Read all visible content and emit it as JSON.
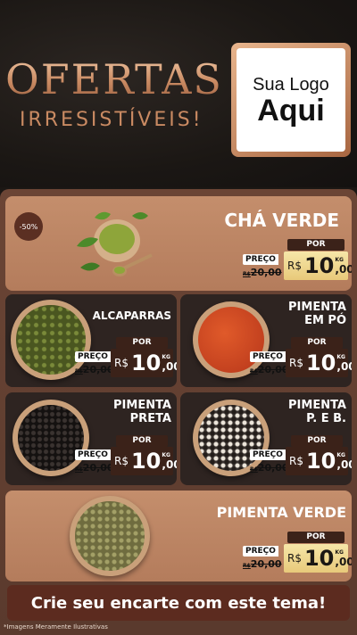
{
  "header": {
    "title": "OFERTAS",
    "subtitle": "IRRESISTÍVEIS!",
    "logo_line1": "Sua Logo",
    "logo_line2": "Aqui"
  },
  "featured": {
    "badge": "-50%",
    "name": "CHÁ VERDE",
    "price_label": "PREÇO",
    "old_price": "20,00",
    "old_currency": "R$",
    "por_label": "POR",
    "currency": "R$",
    "price_int": "10",
    "price_dec": ",00",
    "unit": "KG"
  },
  "products": [
    {
      "name_line1": "ALCAPARRAS",
      "name_line2": "",
      "price_label": "PREÇO",
      "old_currency": "R$",
      "old_price": "20,00",
      "por_label": "POR",
      "currency": "R$",
      "price_int": "10",
      "price_dec": ",00",
      "unit": "KG"
    },
    {
      "name_line1": "PIMENTA",
      "name_line2": "EM PÓ",
      "price_label": "PREÇO",
      "old_currency": "R$",
      "old_price": "20,00",
      "por_label": "POR",
      "currency": "R$",
      "price_int": "10",
      "price_dec": ",00",
      "unit": "KG"
    },
    {
      "name_line1": "PIMENTA",
      "name_line2": "PRETA",
      "price_label": "PREÇO",
      "old_currency": "R$",
      "old_price": "20,00",
      "por_label": "POR",
      "currency": "R$",
      "price_int": "10",
      "price_dec": ",00",
      "unit": "KG"
    },
    {
      "name_line1": "PIMENTA",
      "name_line2": "P. E B.",
      "price_label": "PREÇO",
      "old_currency": "R$",
      "old_price": "20,00",
      "por_label": "POR",
      "currency": "R$",
      "price_int": "10",
      "price_dec": ",00",
      "unit": "KG"
    }
  ],
  "bottom": {
    "name": "PIMENTA VERDE",
    "price_label": "PREÇO",
    "old_currency": "R$",
    "old_price": "20,00",
    "por_label": "POR",
    "currency": "R$",
    "price_int": "10",
    "price_dec": ",00",
    "unit": "KG"
  },
  "footer": {
    "cta": "Crie seu encarte com este tema!",
    "disclaimer": "*Imagens Meramente Ilustrativas"
  },
  "colors": {
    "accent_copper": "#c98a62",
    "price_gold": "#e8c97a",
    "dark_brown": "#3b2219"
  }
}
